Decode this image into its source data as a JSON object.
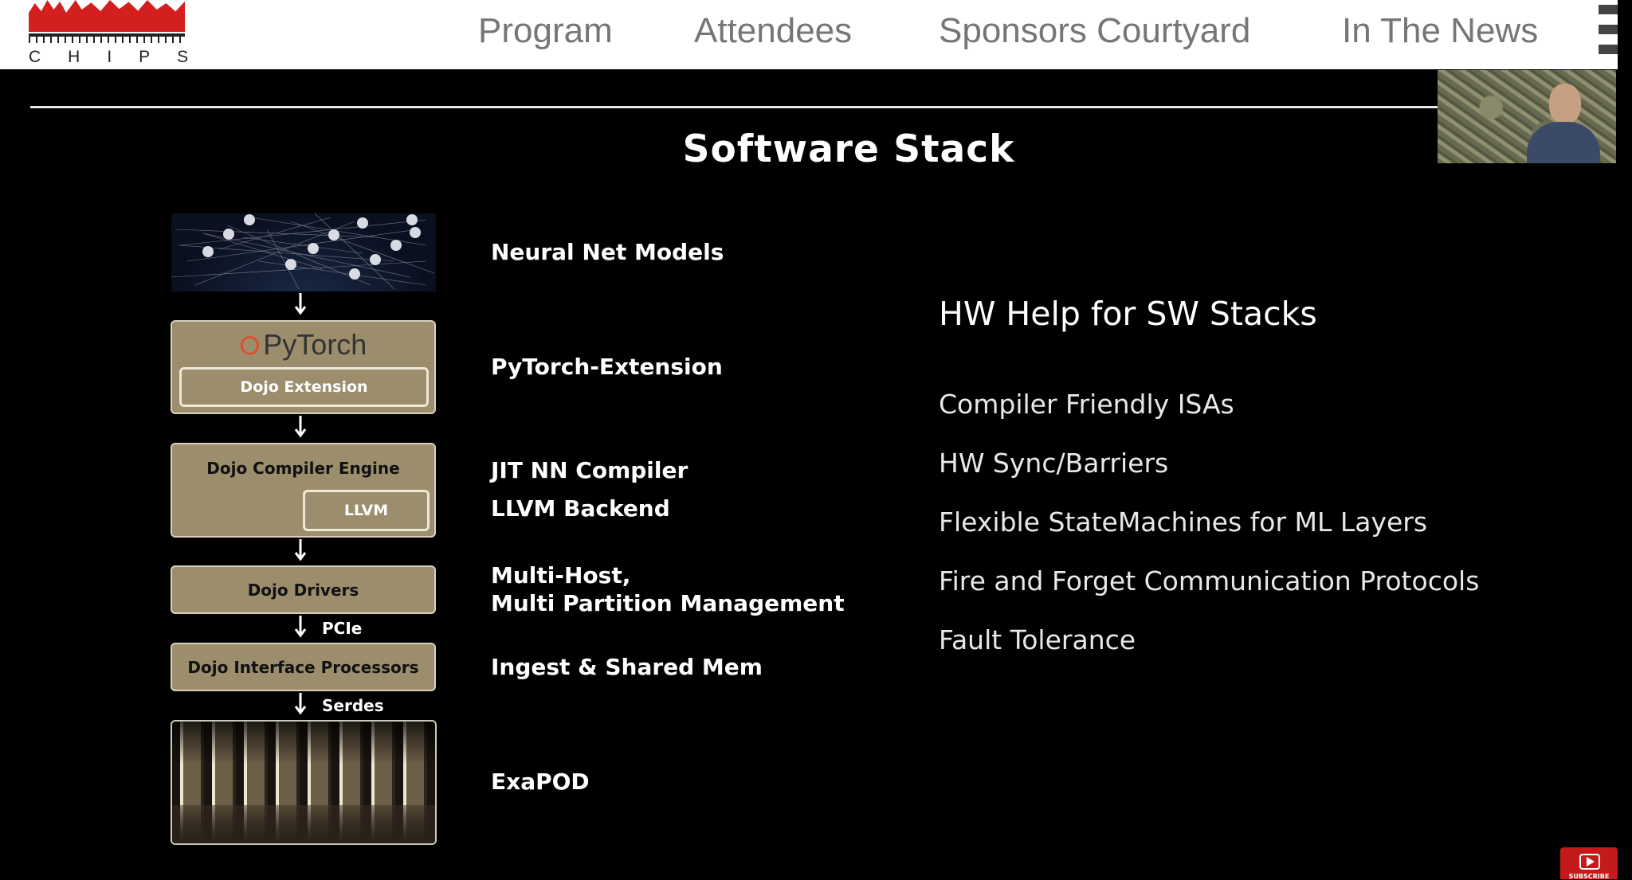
{
  "header": {
    "logo_text": "CHIPS",
    "nav": [
      {
        "label": "Program"
      },
      {
        "label": "Attendees"
      },
      {
        "label": "Sponsors Courtyard"
      },
      {
        "label": "In The News"
      }
    ]
  },
  "slide": {
    "title": "Software Stack",
    "stack": {
      "pytorch_logo": "PyTorch",
      "dojo_extension": "Dojo Extension",
      "compiler_engine": "Dojo Compiler Engine",
      "llvm": "LLVM",
      "drivers": "Dojo Drivers",
      "interface_processors": "Dojo Interface Processors",
      "link_pcie": "PCIe",
      "link_serdes": "Serdes"
    },
    "layers": {
      "neural_net_models": "Neural Net Models",
      "pytorch_extension": "PyTorch-Extension",
      "jit_compiler": "JIT NN Compiler",
      "llvm_backend": "LLVM Backend",
      "multi_host_1": "Multi-Host,",
      "multi_host_2": "Multi Partition Management",
      "ingest": "Ingest & Shared Mem",
      "exapod": "ExaPOD"
    },
    "hw_help": {
      "heading": "HW Help for SW Stacks",
      "items": [
        {
          "label": "Compiler Friendly ISAs"
        },
        {
          "label": "HW Sync/Barriers"
        },
        {
          "label": "Flexible StateMachines for ML Layers"
        },
        {
          "label": "Fire and Forget Communication Protocols"
        },
        {
          "label": "Fault Tolerance"
        }
      ]
    }
  },
  "youtube": {
    "subscribe_label": "SUBSCRIBE"
  }
}
